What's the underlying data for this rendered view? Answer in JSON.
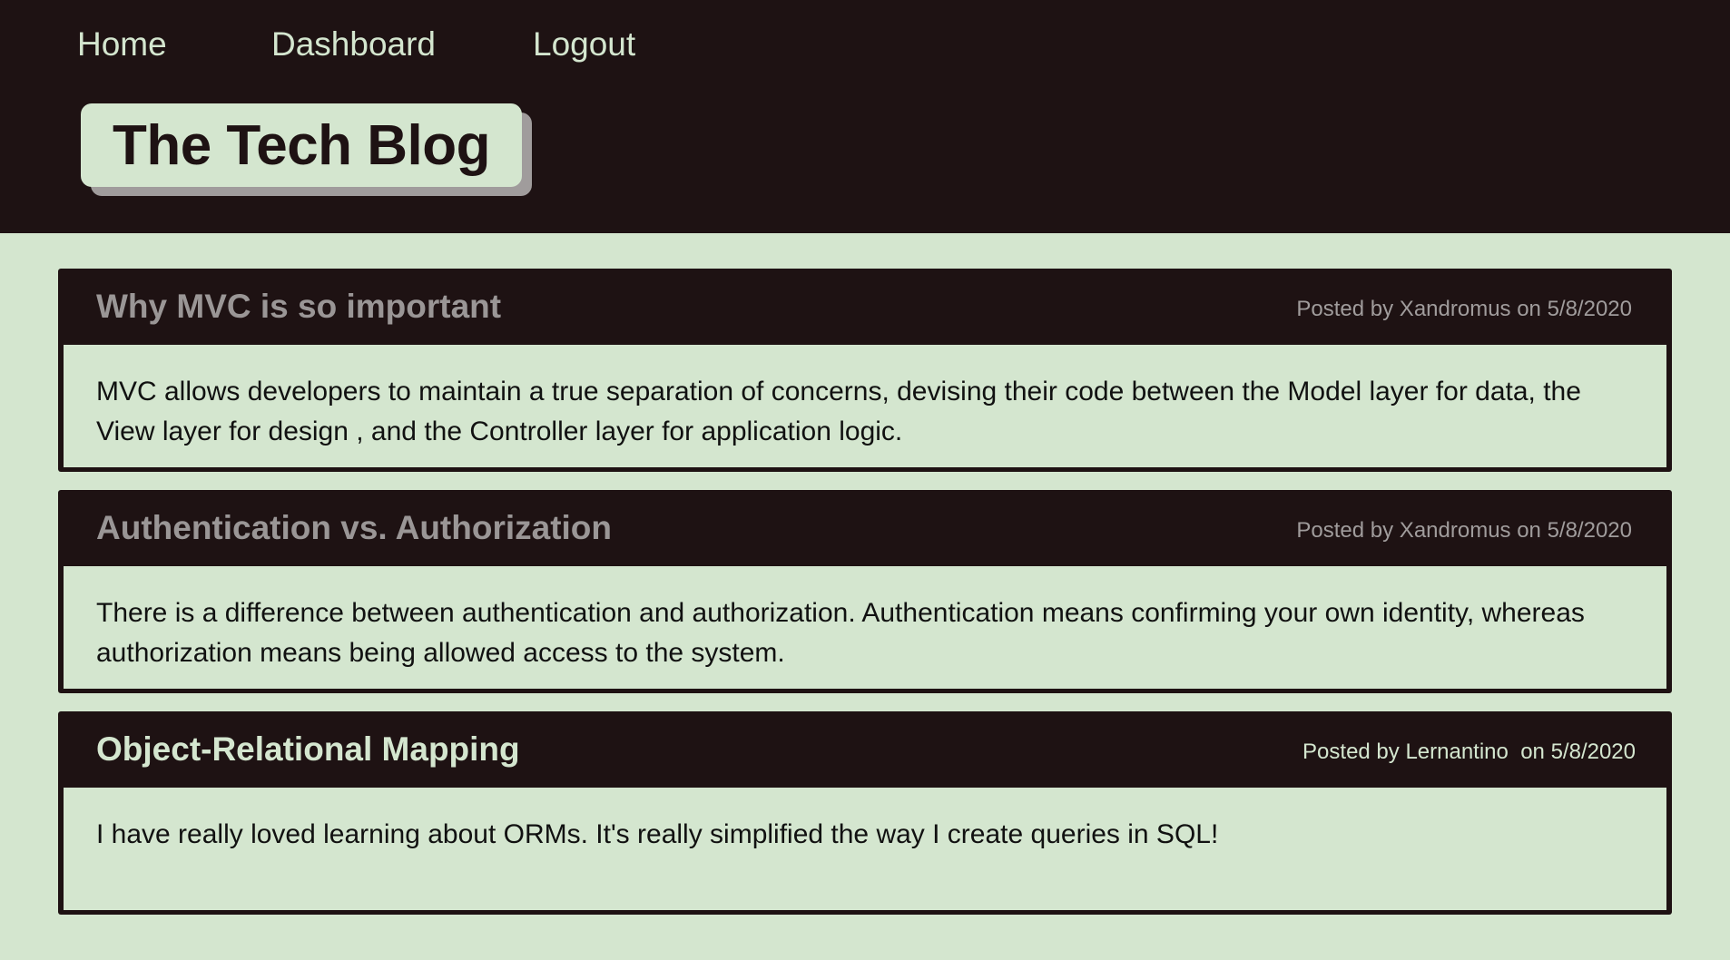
{
  "nav": {
    "home": "Home",
    "dashboard": "Dashboard",
    "logout": "Logout"
  },
  "site_title": "The Tech Blog",
  "posts": [
    {
      "title": "Why MVC is so important",
      "meta": "Posted by Xandromus on 5/8/2020",
      "body": "MVC allows developers to maintain a true separation of concerns, devising their code between the Model layer for data, the View layer for design , and the Controller layer for application logic."
    },
    {
      "title": "Authentication vs. Authorization",
      "meta": "Posted by Xandromus on 5/8/2020",
      "body": "There is a difference between authentication and authorization. Authentication means confirming your own identity, whereas authorization means being allowed access to the system."
    },
    {
      "title": "Object-Relational Mapping",
      "meta": "Posted by Lernantino  on 5/8/2020",
      "body": "I have really loved learning about ORMs. It's really simplified the way I create queries in SQL!"
    }
  ]
}
